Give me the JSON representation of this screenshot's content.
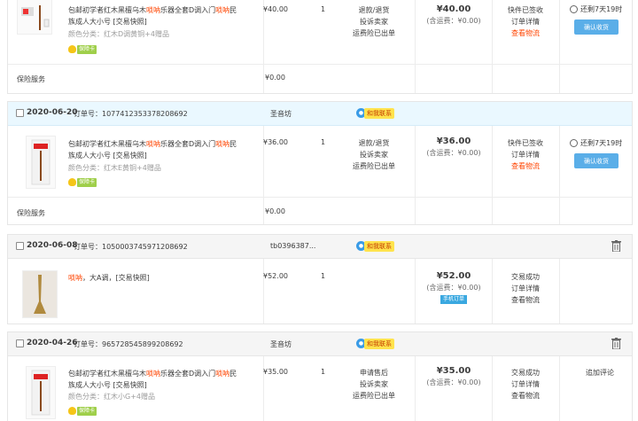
{
  "orders": [
    {
      "product": {
        "title_pre": "包邮初学者红木黑檀乌木",
        "title_hl1": "唢呐",
        "title_mid": "乐器全套D调入门",
        "title_hl2": "唢呐",
        "title_post": "民族成人大小号 [交易快照]",
        "sku": "颜色分类：红木D调黄铜+4赠品",
        "badge": "保障卡"
      },
      "price": "¥40.00",
      "qty": "1",
      "ops": [
        "退款/退货",
        "投诉卖家",
        "运费险已出单"
      ],
      "total": "¥40.00",
      "shipping": "(含运费：¥0.00)",
      "status": [
        "快件已签收",
        "订单详情",
        "查看物流"
      ],
      "timer": "还剩7天19时",
      "confirm": "确认收货",
      "insurance": {
        "label": "保险服务",
        "price": "¥0.00"
      }
    },
    {
      "date": "2020-06-20",
      "order_no": "订单号：1077412353378208692",
      "shop": "圣音坊",
      "chat": "和我联系",
      "product": {
        "title_pre": "包邮初学者红木黑檀乌木",
        "title_hl1": "唢呐",
        "title_mid": "乐器全套D调入门",
        "title_hl2": "唢呐",
        "title_post": "民族成人大小号 [交易快照]",
        "sku": "颜色分类：红木E黄铜+4赠品",
        "badge": "保障卡"
      },
      "price": "¥36.00",
      "qty": "1",
      "ops": [
        "退款/退货",
        "投诉卖家",
        "运费险已出单"
      ],
      "total": "¥36.00",
      "shipping": "(含运费：¥0.00)",
      "status": [
        "快件已签收",
        "订单详情",
        "查看物流"
      ],
      "timer": "还剩7天19时",
      "confirm": "确认收货",
      "insurance": {
        "label": "保险服务",
        "price": "¥0.00"
      }
    },
    {
      "date": "2020-06-08",
      "order_no": "订单号：1050003745971208692",
      "shop": "tb0396387...",
      "chat": "和我联系",
      "product": {
        "title_hl1": "唢呐",
        "title_post": "，大A调，[交易快照]"
      },
      "price": "¥52.00",
      "qty": "1",
      "total": "¥52.00",
      "shipping": "(含运费：¥0.00)",
      "tag": "手机订单",
      "status": [
        "交易成功",
        "订单详情",
        "查看物流"
      ]
    },
    {
      "date": "2020-04-26",
      "order_no": "订单号：965728545899208692",
      "shop": "圣音坊",
      "chat": "和我联系",
      "product": {
        "title_pre": "包邮初学者红木黑檀乌木",
        "title_hl1": "唢呐",
        "title_mid": "乐器全套D调入门",
        "title_hl2": "唢呐",
        "title_post": "民族成人大小号 [交易快照]",
        "sku": "颜色分类：红木小G+4赠品",
        "badge": "保障卡"
      },
      "price": "¥35.00",
      "qty": "1",
      "ops": [
        "申请售后",
        "投诉卖家",
        "运费险已出单"
      ],
      "total": "¥35.00",
      "shipping": "(含运费：¥0.00)",
      "status": [
        "交易成功",
        "订单详情",
        "查看物流"
      ],
      "review": "追加评论"
    }
  ],
  "icons": {
    "trash": "trash-icon",
    "clock": "clock-icon",
    "chat": "chat-icon",
    "badge": "shield-badge-icon"
  },
  "colors": {
    "highlight": "#ff4400",
    "confirm_button": "#5aaee8",
    "header_blue": "#eaf8ff",
    "header_gray": "#f5f5f5",
    "chat_badge": "#ffe34d"
  }
}
